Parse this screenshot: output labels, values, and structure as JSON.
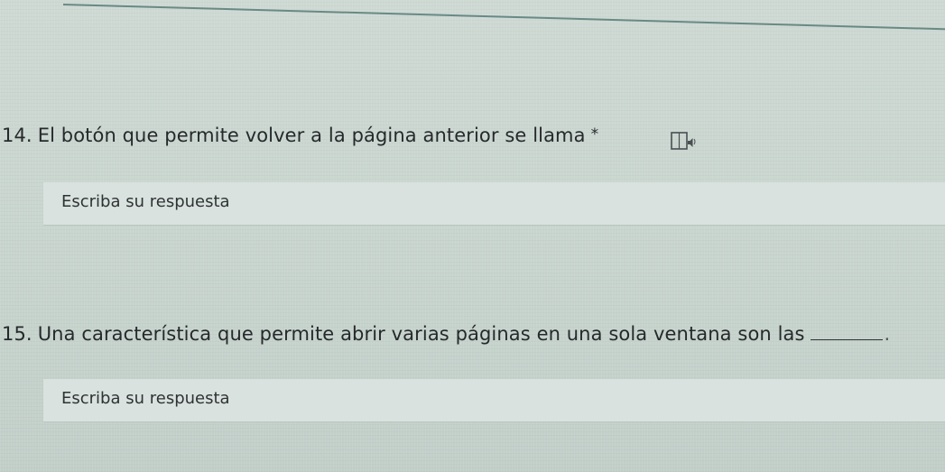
{
  "questions": [
    {
      "number": "14.",
      "text": "El botón que permite volver a la página anterior se llama",
      "required_mark": "*",
      "answer_placeholder": "Escriba su respuesta"
    },
    {
      "number": "15.",
      "text": "Una característica que permite abrir varias páginas en una sola ventana son las",
      "trailing": ".",
      "answer_placeholder": "Escriba su respuesta"
    }
  ],
  "icons": {
    "reader": "immersive-reader-icon"
  }
}
